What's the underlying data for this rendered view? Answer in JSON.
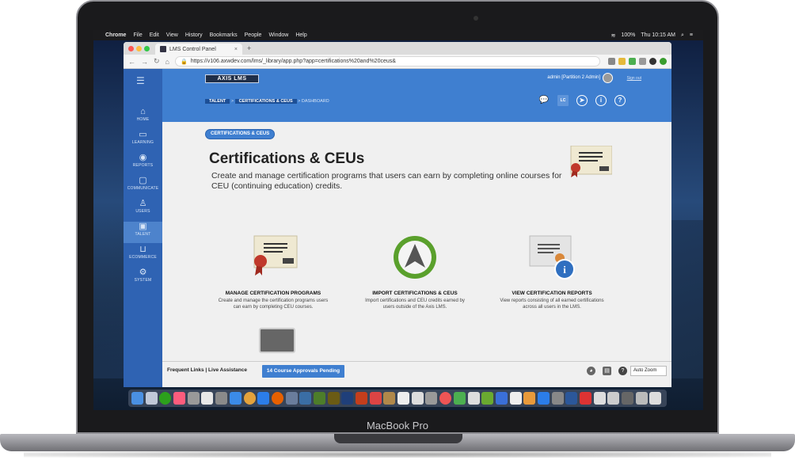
{
  "menubar": {
    "apple": "",
    "app": "Chrome",
    "items": [
      "File",
      "Edit",
      "View",
      "History",
      "Bookmarks",
      "People",
      "Window",
      "Help"
    ],
    "battery": "100%",
    "clock": "Thu 10:15 AM"
  },
  "browser": {
    "tab_title": "LMS Control Panel",
    "tab_close": "×",
    "new_tab": "+",
    "url": "https://v106.axwdev.com/lms/_library/app.php?app=certifications%20and%20ceus&",
    "back": "←",
    "forward": "→",
    "reload": "↻",
    "home": "⌂"
  },
  "app": {
    "logo": "AXIS LMS",
    "user": "admin [Partition 2 Admin]",
    "signout": "Sign out",
    "breadcrumb": {
      "talent": "TALENT",
      "sep": ">",
      "section": "CERTIFICATIONS & CEUS",
      "current": "> DASHBOARD"
    },
    "header_icons": {
      "lc": "LC",
      "info": "i",
      "help": "?"
    },
    "sidebar": [
      {
        "label": "HOME",
        "icon": "⌂"
      },
      {
        "label": "LEARNING",
        "icon": "▭"
      },
      {
        "label": "REPORTS",
        "icon": "◉"
      },
      {
        "label": "COMMUNICATE",
        "icon": "▢"
      },
      {
        "label": "USERS",
        "icon": "♙"
      },
      {
        "label": "TALENT",
        "icon": "▣"
      },
      {
        "label": "ECOMMERCE",
        "icon": "⊔"
      },
      {
        "label": "SYSTEM",
        "icon": "⚙"
      }
    ],
    "section_pill": "CERTIFICATIONS & CEUS",
    "title": "Certifications & CEUs",
    "description": "Create and manage certification programs that users can earn by completing online courses for CEU (continuing education) credits.",
    "cards": [
      {
        "title": "MANAGE CERTIFICATION PROGRAMS",
        "desc": "Create and manage the certification programs users can earn by completing CEU courses."
      },
      {
        "title": "IMPORT CERTIFICATIONS & CEUS",
        "desc": "Import certifications and CEU credits earned by users outside of the Axis LMS."
      },
      {
        "title": "VIEW CERTIFICATION REPORTS",
        "desc": "View reports consisting of all earned certifications across all users in the LMS."
      }
    ],
    "footer": {
      "frequent_links": "Frequent Links",
      "divider": "|",
      "live_assistance": "Live Assistance",
      "pending": "14 Course Approvals Pending",
      "help": "?",
      "zoom": "Auto Zoom"
    }
  },
  "laptop_brand": "MacBook Pro",
  "colors": {
    "primary": "#3f7fd0",
    "sidebar": "#2f63b3",
    "dark_pill": "#1d4f96",
    "green": "#5aa02c"
  }
}
